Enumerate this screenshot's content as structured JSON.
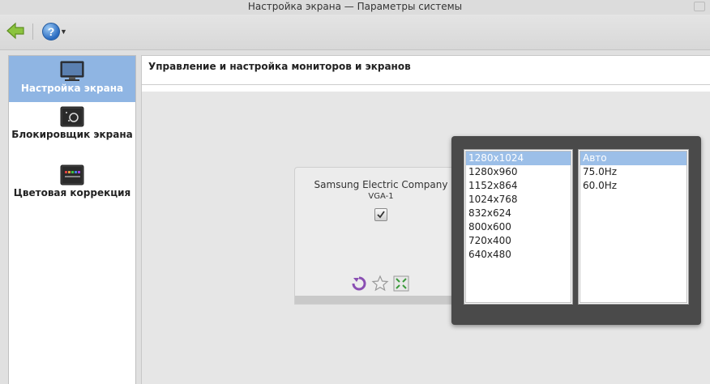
{
  "window": {
    "title": "Настройка экрана — Параметры системы"
  },
  "toolbar": {
    "back_icon": "arrow-left-icon",
    "help_label": "?",
    "help_icon": "help-icon"
  },
  "sidebar": {
    "items": [
      {
        "label": "Настройка экрана",
        "icon": "monitor-icon",
        "active": true
      },
      {
        "label": "Блокировщик экрана",
        "icon": "screen-locker-icon",
        "active": false
      },
      {
        "label": "Цветовая коррекция",
        "icon": "color-correction-icon",
        "active": false
      }
    ]
  },
  "main": {
    "header": "Управление и настройка мониторов и экранов"
  },
  "monitor": {
    "name": "Samsung Electric Company",
    "output": "VGA-1"
  },
  "popup": {
    "resolutions": [
      "1280x1024",
      "1280x960",
      "1152x864",
      "1024x768",
      "832x624",
      "800x600",
      "720x400",
      "640x480"
    ],
    "selected_resolution": "1280x1024",
    "refresh_rates": [
      "Авто",
      "75.0Hz",
      "60.0Hz"
    ],
    "selected_refresh": "Авто"
  },
  "colors": {
    "accent": "#8fb5e3",
    "selection": "#9cbfe8",
    "popup_bg": "#4a4a4a",
    "back_arrow": "#7fb33c",
    "rotate_icon": "#8a4fb3"
  }
}
